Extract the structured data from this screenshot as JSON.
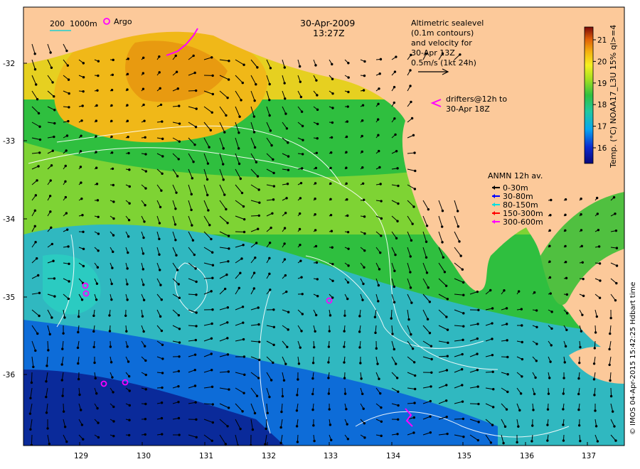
{
  "map": {
    "date": "30-Apr-2009",
    "time": "13:27Z",
    "scale_bar": {
      "label_a": "200",
      "label_b": "1000m"
    },
    "argo_label": "Argo",
    "altimetry_note": [
      "Altimetric sealevel",
      "(0.1m contours)",
      "and velocity for",
      "30-Apr 13Z",
      "0.5m/s (1kt 24h)"
    ],
    "drifters_note": [
      "drifters@12h to",
      "30-Apr 18Z"
    ],
    "anmn": {
      "title": "ANMN 12h av.",
      "items": [
        {
          "label": "0-30m",
          "color": "#000000"
        },
        {
          "label": "30-80m",
          "color": "#0000ff"
        },
        {
          "label": "80-150m",
          "color": "#00e0e0"
        },
        {
          "label": "150-300m",
          "color": "#ff0000"
        },
        {
          "label": "300-600m",
          "color": "#ff00ff"
        }
      ]
    },
    "colorbar": {
      "title": "Temp. (°C) NOAA17_L3U 15% ql>=4",
      "ticks": [
        "16",
        "17",
        "18",
        "19",
        "20",
        "21"
      ]
    },
    "credit": "© IMOS 04-Apr-2015 15:42:25 Hdbart time",
    "x_ticks": [
      "129",
      "130",
      "131",
      "132",
      "133",
      "134",
      "135",
      "136",
      "137"
    ],
    "y_ticks": [
      "-32",
      "-33",
      "-34",
      "-35",
      "-36"
    ],
    "colors": {
      "land": "#fcc99a",
      "deep_cold": "#08207a",
      "warm": "#e8a000"
    }
  }
}
